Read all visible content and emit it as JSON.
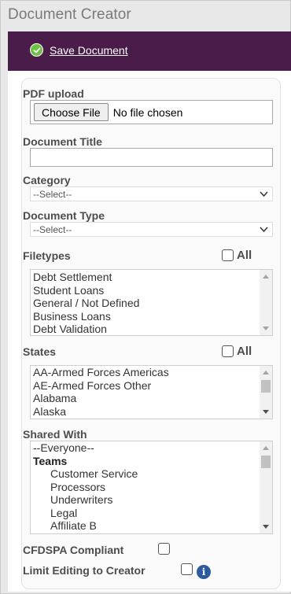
{
  "app": {
    "title": "Document Creator"
  },
  "toolbar": {
    "save_label": "Save Document",
    "save_icon": "check-circle-icon",
    "accent": "#4a1c4a"
  },
  "form": {
    "pdf_upload": {
      "label": "PDF upload",
      "button": "Choose File",
      "status": "No file chosen"
    },
    "document_title": {
      "label": "Document Title",
      "value": ""
    },
    "category": {
      "label": "Category",
      "selected": "--Select--"
    },
    "document_type": {
      "label": "Document Type",
      "selected": "--Select--"
    },
    "filetypes": {
      "label": "Filetypes",
      "all_label": "All",
      "all_checked": false,
      "options": [
        "Debt Settlement",
        "Student Loans",
        "General / Not Defined",
        "Business Loans",
        "Debt Validation"
      ]
    },
    "states": {
      "label": "States",
      "all_label": "All",
      "all_checked": false,
      "options": [
        "AA-Armed Forces Americas",
        "AE-Armed Forces Other",
        "Alabama",
        "Alaska"
      ]
    },
    "shared_with": {
      "label": "Shared With",
      "options": [
        {
          "text": "--Everyone--",
          "kind": "option"
        },
        {
          "text": "Teams",
          "kind": "group"
        },
        {
          "text": "Customer Service",
          "kind": "indent"
        },
        {
          "text": "Processors",
          "kind": "indent"
        },
        {
          "text": "Underwriters",
          "kind": "indent"
        },
        {
          "text": "Legal",
          "kind": "indent"
        },
        {
          "text": "Affiliate B",
          "kind": "indent"
        }
      ]
    },
    "cfdspa": {
      "label": "CFDSPA Compliant",
      "checked": false
    },
    "limit_editing": {
      "label": "Limit Editing to Creator",
      "checked": false,
      "info_icon": "info-icon"
    }
  }
}
